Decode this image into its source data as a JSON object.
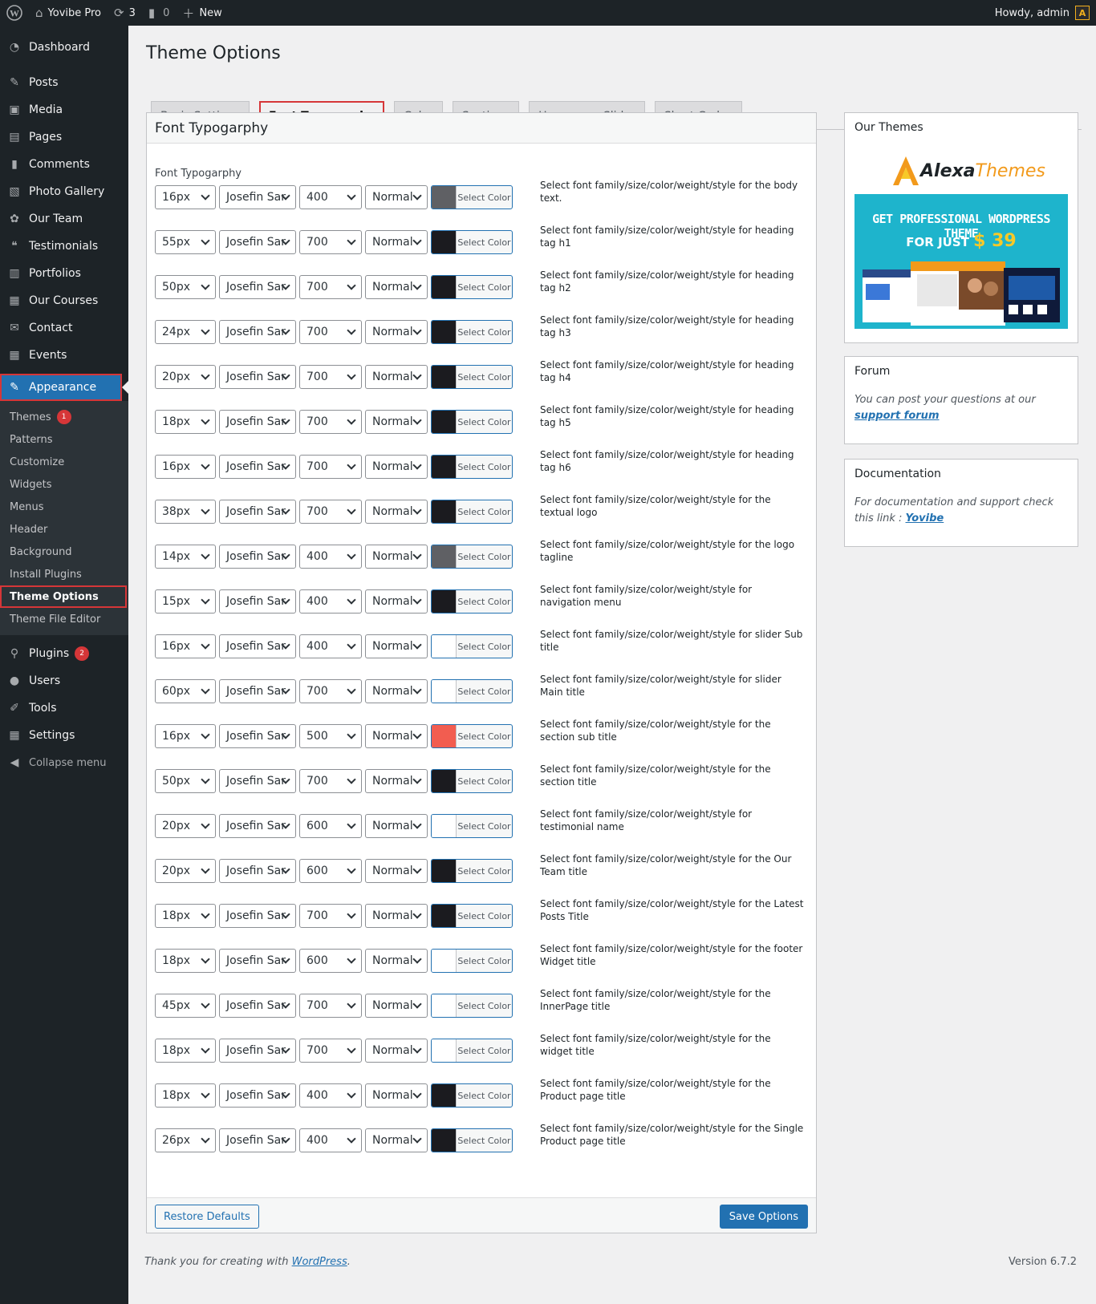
{
  "adminbar": {
    "site_name": "Yovibe Pro",
    "updates_count": "3",
    "comments_count": "0",
    "new_label": "New",
    "howdy": "Howdy, admin",
    "avatar_letter": "A"
  },
  "sidebar": {
    "items_top": [
      {
        "label": "Dashboard",
        "icon": "dashboard-icon"
      }
    ],
    "items": [
      {
        "label": "Posts",
        "icon": "pin-icon"
      },
      {
        "label": "Media",
        "icon": "media-icon"
      },
      {
        "label": "Pages",
        "icon": "pages-icon"
      },
      {
        "label": "Comments",
        "icon": "comments-icon"
      },
      {
        "label": "Photo Gallery",
        "icon": "gallery-icon"
      },
      {
        "label": "Our Team",
        "icon": "team-icon"
      },
      {
        "label": "Testimonials",
        "icon": "quote-icon"
      },
      {
        "label": "Portfolios",
        "icon": "portfolio-icon"
      },
      {
        "label": "Our Courses",
        "icon": "courses-icon"
      },
      {
        "label": "Contact",
        "icon": "mail-icon"
      },
      {
        "label": "Events",
        "icon": "calendar-icon"
      }
    ],
    "appearance": "Appearance",
    "submenu": [
      "Themes",
      "Patterns",
      "Customize",
      "Widgets",
      "Menus",
      "Header",
      "Background",
      "Install Plugins",
      "Theme Options",
      "Theme File Editor"
    ],
    "themes_badge": "1",
    "bottom": [
      {
        "label": "Plugins",
        "icon": "plugins-icon",
        "badge": "2"
      },
      {
        "label": "Users",
        "icon": "users-icon"
      },
      {
        "label": "Tools",
        "icon": "tools-icon"
      },
      {
        "label": "Settings",
        "icon": "settings-icon"
      }
    ],
    "collapse": "Collapse menu"
  },
  "page": {
    "title": "Theme Options",
    "tabs": [
      "Basic Settings",
      "Font Typogarphy",
      "Color",
      "Sections",
      "Homepage Slider",
      "Short Codes"
    ],
    "active_tab": "Font Typogarphy"
  },
  "typography": {
    "panel_title": "Font Typogarphy",
    "section_label": "Font Typogarphy",
    "select_color_label": "Select Color",
    "rows": [
      {
        "size": "16px",
        "family": "Josefin Sar",
        "weight": "400",
        "style": "Normal",
        "color": "#5f6064",
        "desc": "Select font family/size/color/weight/style for the body text."
      },
      {
        "size": "55px",
        "family": "Josefin Sar",
        "weight": "700",
        "style": "Normal",
        "color": "#1b1b1f",
        "desc": "Select font family/size/color/weight/style for heading tag h1"
      },
      {
        "size": "50px",
        "family": "Josefin Sar",
        "weight": "700",
        "style": "Normal",
        "color": "#1b1b1f",
        "desc": "Select font family/size/color/weight/style for heading tag h2"
      },
      {
        "size": "24px",
        "family": "Josefin Sar",
        "weight": "700",
        "style": "Normal",
        "color": "#1b1b1f",
        "desc": "Select font family/size/color/weight/style for heading tag h3"
      },
      {
        "size": "20px",
        "family": "Josefin Sar",
        "weight": "700",
        "style": "Normal",
        "color": "#1b1b1f",
        "desc": "Select font family/size/color/weight/style for heading tag h4"
      },
      {
        "size": "18px",
        "family": "Josefin Sar",
        "weight": "700",
        "style": "Normal",
        "color": "#1b1b1f",
        "desc": "Select font family/size/color/weight/style for heading tag h5"
      },
      {
        "size": "16px",
        "family": "Josefin Sar",
        "weight": "700",
        "style": "Normal",
        "color": "#1b1b1f",
        "desc": "Select font family/size/color/weight/style for heading tag h6"
      },
      {
        "size": "38px",
        "family": "Josefin Sar",
        "weight": "700",
        "style": "Normal",
        "color": "#1b1b1f",
        "desc": "Select font family/size/color/weight/style for the textual logo"
      },
      {
        "size": "14px",
        "family": "Josefin Sar",
        "weight": "400",
        "style": "Normal",
        "color": "#5f6064",
        "desc": "Select font family/size/color/weight/style for the logo tagline"
      },
      {
        "size": "15px",
        "family": "Josefin Sar",
        "weight": "400",
        "style": "Normal",
        "color": "#1b1b1f",
        "desc": "Select font family/size/color/weight/style for navigation menu"
      },
      {
        "size": "16px",
        "family": "Josefin Sar",
        "weight": "400",
        "style": "Normal",
        "color": "#ffffff",
        "desc": "Select font family/size/color/weight/style for slider Sub title"
      },
      {
        "size": "60px",
        "family": "Josefin Sar",
        "weight": "700",
        "style": "Normal",
        "color": "#ffffff",
        "desc": "Select font family/size/color/weight/style for slider Main title"
      },
      {
        "size": "16px",
        "family": "Josefin Sar",
        "weight": "500",
        "style": "Normal",
        "color": "#f25d50",
        "desc": "Select font family/size/color/weight/style for the section sub title"
      },
      {
        "size": "50px",
        "family": "Josefin Sar",
        "weight": "700",
        "style": "Normal",
        "color": "#1b1b1f",
        "desc": "Select font family/size/color/weight/style for the section title"
      },
      {
        "size": "20px",
        "family": "Josefin Sar",
        "weight": "600",
        "style": "Normal",
        "color": "#ffffff",
        "desc": "Select font family/size/color/weight/style for testimonial name"
      },
      {
        "size": "20px",
        "family": "Josefin Sar",
        "weight": "600",
        "style": "Normal",
        "color": "#1b1b1f",
        "desc": "Select font family/size/color/weight/style for the Our Team title"
      },
      {
        "size": "18px",
        "family": "Josefin Sar",
        "weight": "700",
        "style": "Normal",
        "color": "#1b1b1f",
        "desc": "Select font family/size/color/weight/style for the Latest Posts Title"
      },
      {
        "size": "18px",
        "family": "Josefin Sar",
        "weight": "600",
        "style": "Normal",
        "color": "#ffffff",
        "desc": "Select font family/size/color/weight/style for the footer Widget title"
      },
      {
        "size": "45px",
        "family": "Josefin Sar",
        "weight": "700",
        "style": "Normal",
        "color": "#ffffff",
        "desc": "Select font family/size/color/weight/style for the InnerPage title"
      },
      {
        "size": "18px",
        "family": "Josefin Sar",
        "weight": "700",
        "style": "Normal",
        "color": "#ffffff",
        "desc": "Select font family/size/color/weight/style for the widget title"
      },
      {
        "size": "18px",
        "family": "Josefin Sar",
        "weight": "400",
        "style": "Normal",
        "color": "#1b1b1f",
        "desc": "Select font family/size/color/weight/style for the Product page title"
      },
      {
        "size": "26px",
        "family": "Josefin Sar",
        "weight": "400",
        "style": "Normal",
        "color": "#1b1b1f",
        "desc": "Select font family/size/color/weight/style for the Single Product page title"
      }
    ],
    "restore_label": "Restore Defaults",
    "save_label": "Save Options"
  },
  "widgets": {
    "themes_title": "Our Themes",
    "promo_brand_main": "Alexa",
    "promo_brand_accent": "Themes",
    "promo_line1": "GET PROFESSIONAL WORDPRESS THEME",
    "promo_line2": "FOR JUST",
    "promo_price": "$ 39",
    "forum_title": "Forum",
    "forum_text": "You can post your questions at our",
    "forum_link": "support forum",
    "docs_title": "Documentation",
    "docs_text": "For documentation and support check this link :",
    "docs_link": "Yovibe"
  },
  "footer": {
    "thanks_prefix": "Thank you for creating with",
    "thanks_link": "WordPress",
    "version": "Version 6.7.2"
  },
  "colors": {
    "accent": "#2271b1",
    "highlight": "#d63638",
    "sidebar_bg": "#1d2327"
  }
}
